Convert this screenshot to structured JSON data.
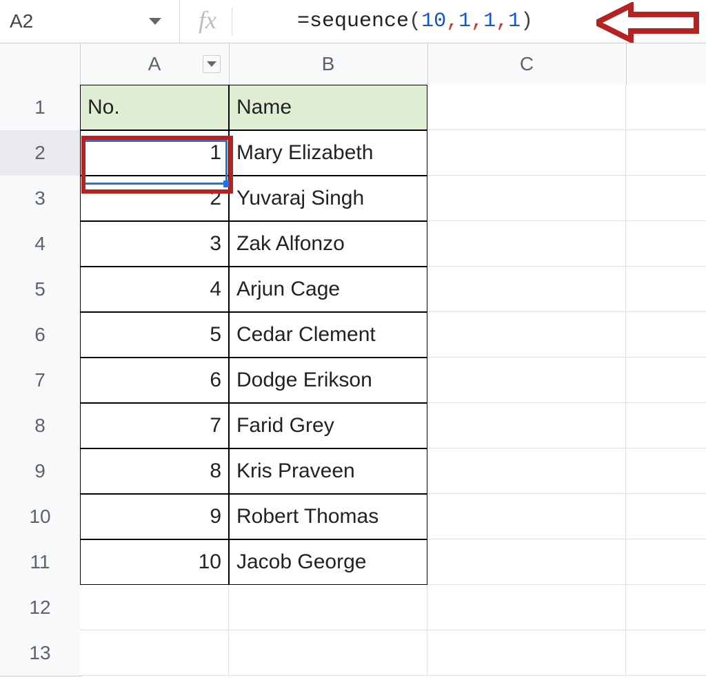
{
  "namebox": {
    "value": "A2"
  },
  "formula": {
    "prefix": "=",
    "func": "sequence",
    "open": "(",
    "arg1": "10",
    "comma": ",",
    "arg2": "1",
    "arg3": "1",
    "arg4": "1",
    "close": ")"
  },
  "columns": {
    "A": "A",
    "B": "B",
    "C": "C"
  },
  "rows": [
    "1",
    "2",
    "3",
    "4",
    "5",
    "6",
    "7",
    "8",
    "9",
    "10",
    "11",
    "12",
    "13"
  ],
  "table": {
    "headers": {
      "no": "No.",
      "name": "Name"
    },
    "rows": [
      {
        "no": "1",
        "name": "Mary Elizabeth"
      },
      {
        "no": "2",
        "name": "Yuvaraj Singh"
      },
      {
        "no": "3",
        "name": "Zak Alfonzo"
      },
      {
        "no": "4",
        "name": "Arjun Cage"
      },
      {
        "no": "5",
        "name": "Cedar Clement"
      },
      {
        "no": "6",
        "name": "Dodge Erikson"
      },
      {
        "no": "7",
        "name": "Farid Grey"
      },
      {
        "no": "8",
        "name": "Kris Praveen"
      },
      {
        "no": "9",
        "name": "Robert Thomas"
      },
      {
        "no": "10",
        "name": "Jacob George"
      }
    ]
  }
}
